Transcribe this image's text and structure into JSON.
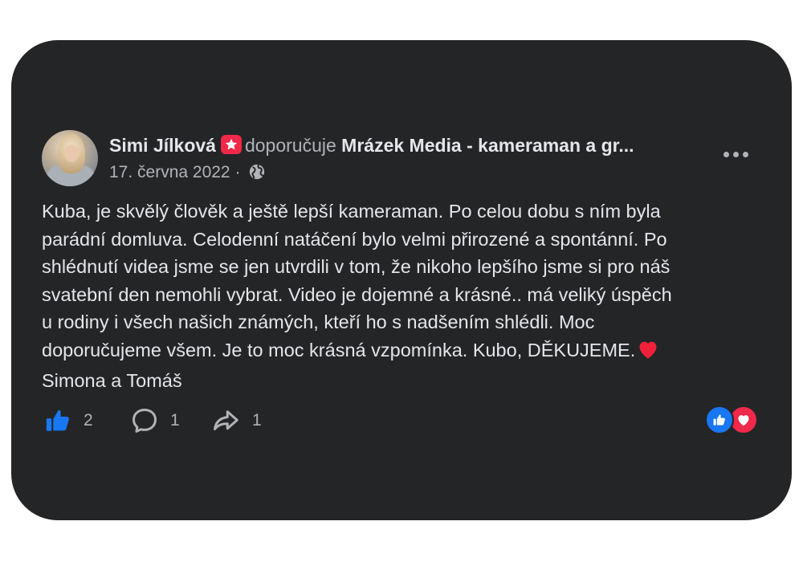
{
  "post": {
    "author": "Simi Jílková",
    "verb": "doporučuje",
    "page_name": "Mrázek Media - kameraman a gr...",
    "date": "17. června 2022",
    "separator": "·",
    "text": "Kuba, je skvělý člověk a ještě lepší kameraman. Po celou dobu s ním byla\nparádní domluva. Celodenní natáčení bylo velmi přirozené a spontánní. Po\nshlédnutí videa jsme se jen utvrdili v tom, že nikoho lepšího jsme si pro náš\nsvatební den nemohli vybrat. Video je dojemné a krásné.. má veliký úspěch\nu rodiny i všech našich známých, kteří ho s nadšením shlédli. Moc\ndoporučujeme všem. Je to moc krásná vzpomínka. Kubo, DĚKUJEME.",
    "signature": "Simona a Tomáš"
  },
  "actions": {
    "likes": "2",
    "comments": "1",
    "shares": "1"
  },
  "icons": {
    "badge": "recommend-star-icon",
    "privacy": "globe-icon",
    "more": "more-options-icon",
    "like": "thumbs-up-icon",
    "comment": "comment-bubble-icon",
    "share": "share-arrow-icon",
    "reaction_like": "like-reaction-icon",
    "reaction_love": "love-reaction-icon",
    "inline_heart": "red-heart-emoji-icon"
  },
  "colors": {
    "card_background": "#242526",
    "primary_text": "#e4e6eb",
    "secondary_text": "#b0b3b8",
    "like_blue": "#1877f2",
    "love_red": "#f02849"
  }
}
